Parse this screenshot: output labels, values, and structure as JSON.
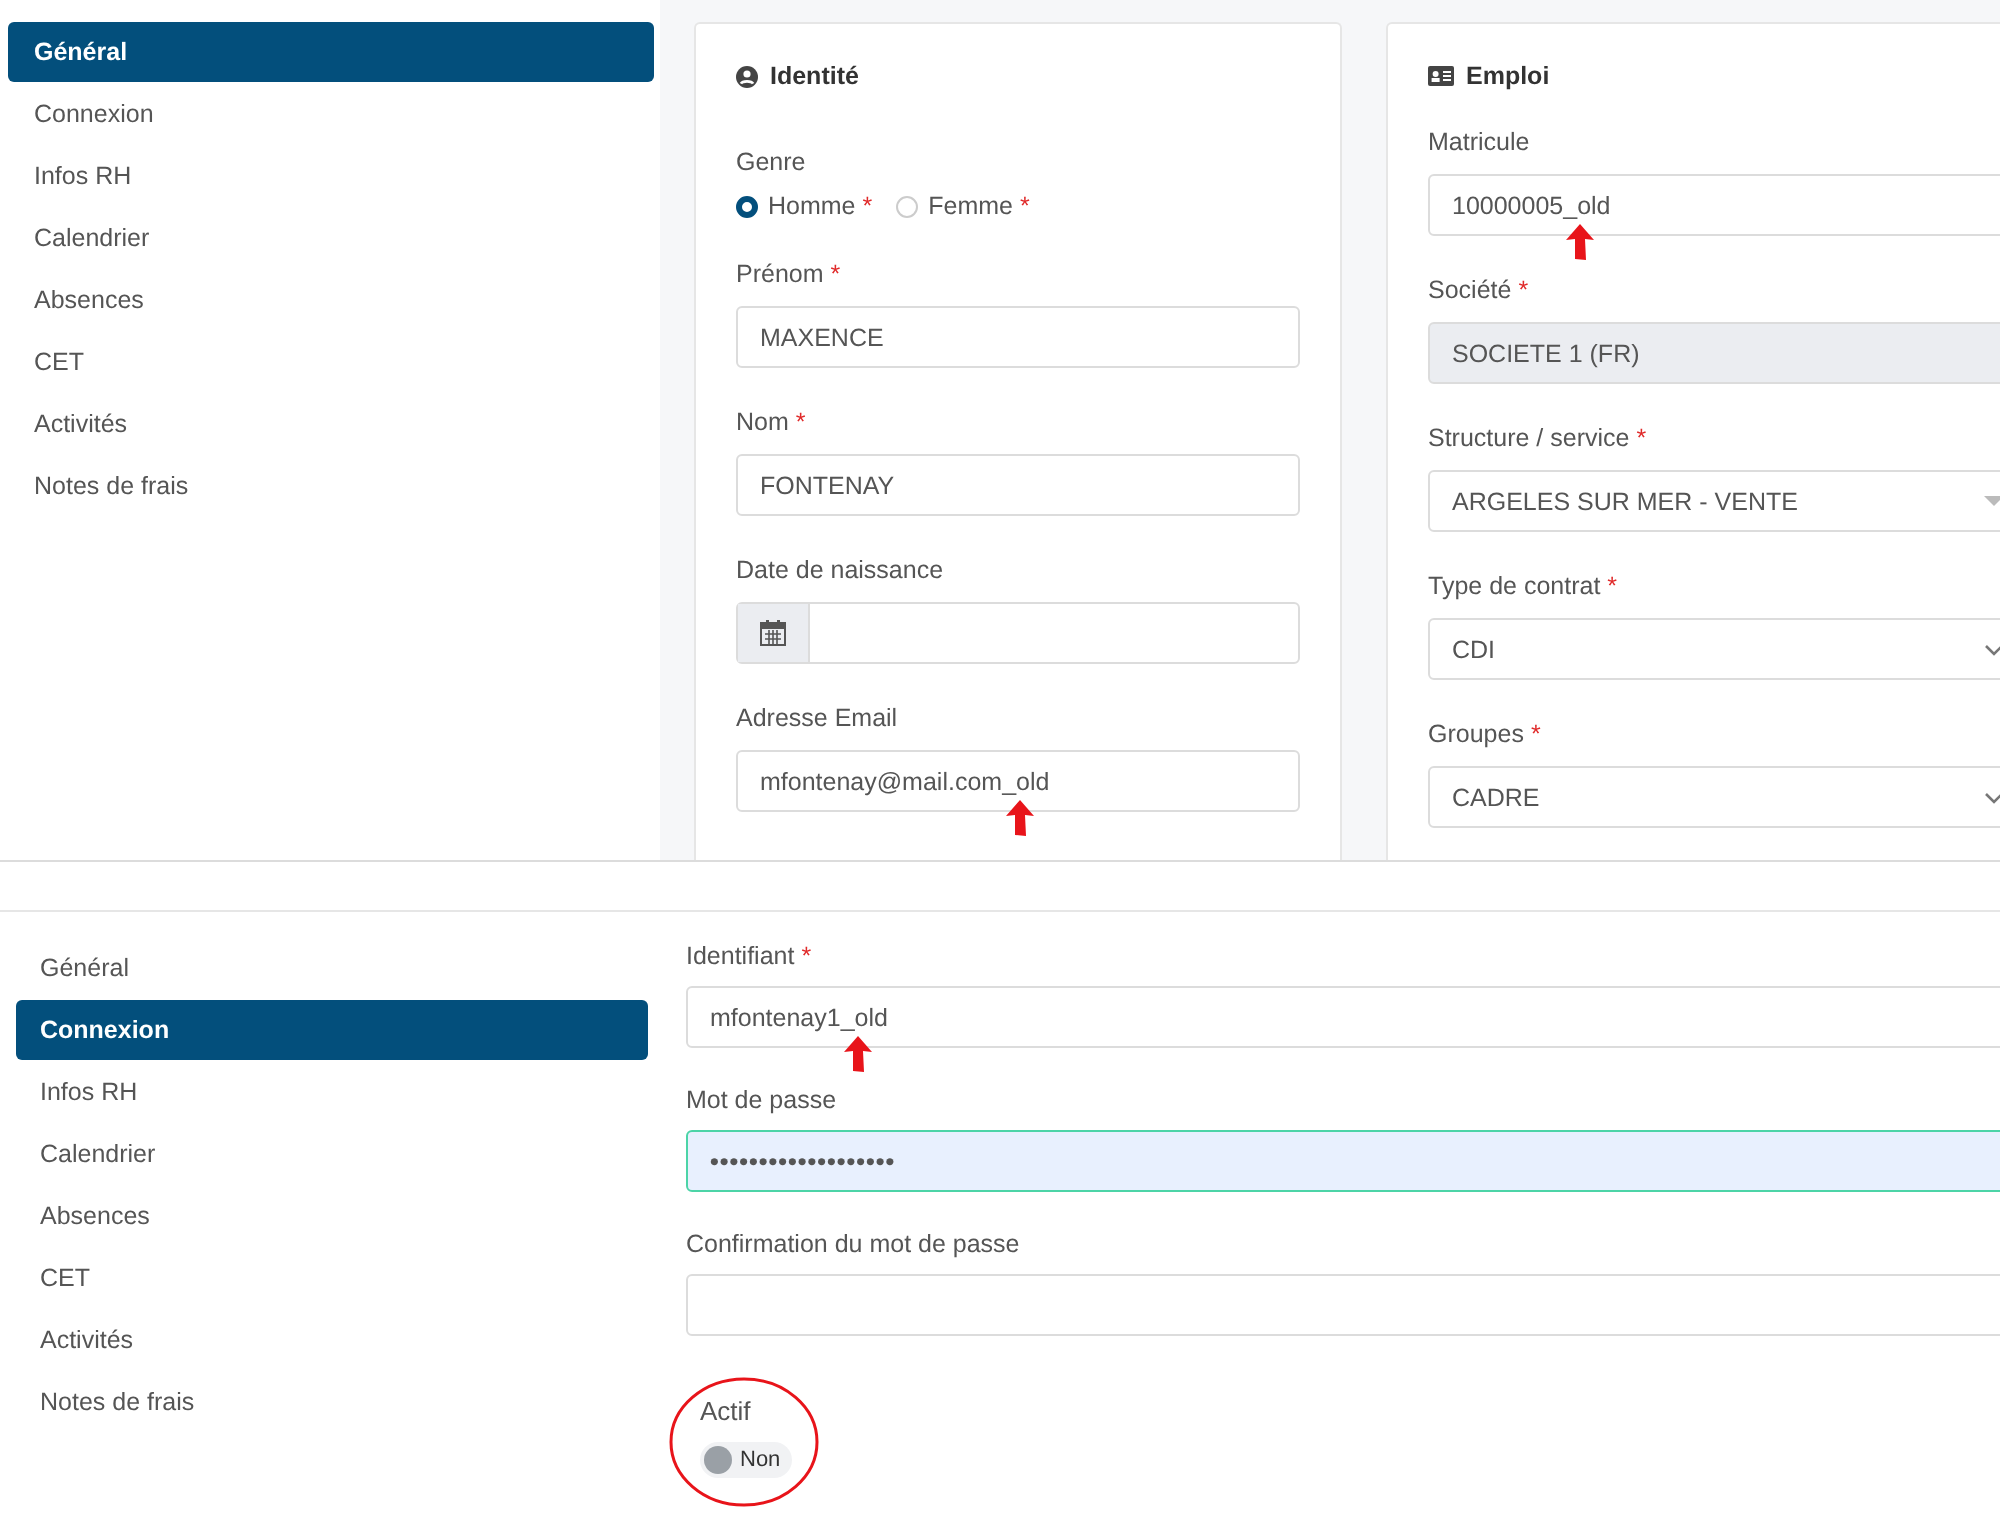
{
  "general_view": {
    "sidebar": {
      "items": [
        {
          "label": "Général",
          "selected": true
        },
        {
          "label": "Connexion",
          "selected": false
        },
        {
          "label": "Infos RH",
          "selected": false
        },
        {
          "label": "Calendrier",
          "selected": false
        },
        {
          "label": "Absences",
          "selected": false
        },
        {
          "label": "CET",
          "selected": false
        },
        {
          "label": "Activités",
          "selected": false
        },
        {
          "label": "Notes de frais",
          "selected": false
        }
      ]
    },
    "cards": [
      {
        "title": "Identité",
        "fields": [
          {
            "kind": "radio",
            "label": "Genre",
            "options": [
              {
                "label": "Homme",
                "required_mark": "*",
                "selected": true
              },
              {
                "label": "Femme",
                "required_mark": "*",
                "selected": false
              }
            ]
          },
          {
            "kind": "text",
            "label": "Prénom",
            "required_mark": "*",
            "value": "MAXENCE",
            "annotated": false
          },
          {
            "kind": "text",
            "label": "Nom",
            "required_mark": "*",
            "value": "FONTENAY",
            "annotated": false
          },
          {
            "kind": "date",
            "label": "Date de naissance"
          },
          {
            "kind": "text",
            "label": "Adresse Email",
            "value": "mfontenay@mail.com_old",
            "annotated": true
          }
        ]
      },
      {
        "title": "Emploi",
        "fields": [
          {
            "kind": "text",
            "label": "Matricule",
            "value": "10000005_old",
            "annotated": true
          },
          {
            "kind": "readonly",
            "label": "Société",
            "required_mark": "*",
            "value": "SOCIETE 1 (FR)"
          },
          {
            "kind": "combo",
            "label": "Structure / service",
            "required_mark": "*",
            "value": "ARGELES SUR MER - VENTE"
          },
          {
            "kind": "select",
            "label": "Type de contrat",
            "required_mark": "*",
            "value": "CDI"
          },
          {
            "kind": "select",
            "label": "Groupes",
            "required_mark": "*",
            "value": "CADRE"
          }
        ]
      }
    ]
  },
  "connexion_view": {
    "sidebar": {
      "items": [
        {
          "label": "Général",
          "selected": false
        },
        {
          "label": "Connexion",
          "selected": true
        },
        {
          "label": "Infos RH",
          "selected": false
        },
        {
          "label": "Calendrier",
          "selected": false
        },
        {
          "label": "Absences",
          "selected": false
        },
        {
          "label": "CET",
          "selected": false
        },
        {
          "label": "Activités",
          "selected": false
        },
        {
          "label": "Notes de frais",
          "selected": false
        }
      ]
    },
    "fields": [
      {
        "kind": "text",
        "label": "Identifiant",
        "required_mark": "*",
        "value": "mfontenay1_old",
        "annotated": true
      },
      {
        "kind": "password",
        "label": "Mot de passe",
        "value": "•••••••••••••••••••",
        "focused": true
      },
      {
        "kind": "password",
        "label": "Confirmation du mot de passe",
        "focused": false
      }
    ],
    "toggle": {
      "label": "Actif",
      "on": false,
      "text": "Non",
      "circled": true
    }
  }
}
